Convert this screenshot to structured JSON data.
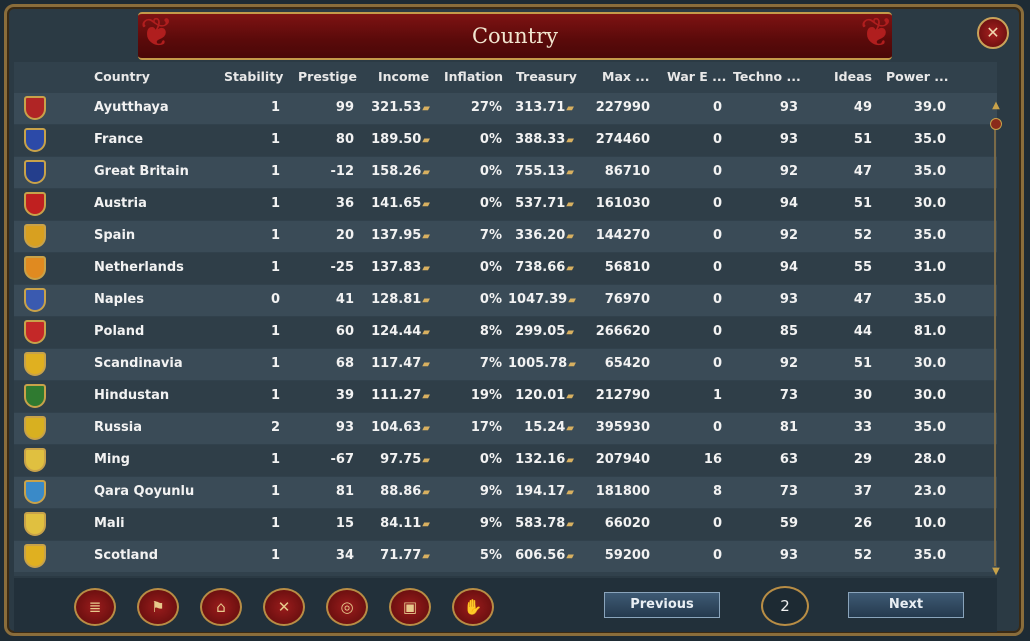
{
  "title": "Country",
  "columns": [
    "Country",
    "Stability",
    "Prestige",
    "Income",
    "Inflation",
    "Treasury",
    "Max ...",
    "War E ...",
    "Techno ...",
    "Ideas",
    "Power ..."
  ],
  "rows": [
    {
      "name": "Ayutthaya",
      "stability": "1",
      "prestige": "99",
      "income": "321.53",
      "inflation": "27%",
      "treasury": "313.71",
      "max": "227990",
      "war": "0",
      "tech": "93",
      "ideas": "49",
      "power": "39.0",
      "shield": "#b02525"
    },
    {
      "name": "France",
      "stability": "1",
      "prestige": "80",
      "income": "189.50",
      "inflation": "0%",
      "treasury": "388.33",
      "max": "274460",
      "war": "0",
      "tech": "93",
      "ideas": "51",
      "power": "35.0",
      "shield": "#2c4aa8"
    },
    {
      "name": "Great Britain",
      "stability": "1",
      "prestige": "-12",
      "income": "158.26",
      "inflation": "0%",
      "treasury": "755.13",
      "max": "86710",
      "war": "0",
      "tech": "92",
      "ideas": "47",
      "power": "35.0",
      "shield": "#243e8c"
    },
    {
      "name": "Austria",
      "stability": "1",
      "prestige": "36",
      "income": "141.65",
      "inflation": "0%",
      "treasury": "537.71",
      "max": "161030",
      "war": "0",
      "tech": "94",
      "ideas": "51",
      "power": "30.0",
      "shield": "#c02020"
    },
    {
      "name": "Spain",
      "stability": "1",
      "prestige": "20",
      "income": "137.95",
      "inflation": "7%",
      "treasury": "336.20",
      "max": "144270",
      "war": "0",
      "tech": "92",
      "ideas": "52",
      "power": "35.0",
      "shield": "#d8a020"
    },
    {
      "name": "Netherlands",
      "stability": "1",
      "prestige": "-25",
      "income": "137.83",
      "inflation": "0%",
      "treasury": "738.66",
      "max": "56810",
      "war": "0",
      "tech": "94",
      "ideas": "55",
      "power": "31.0",
      "shield": "#e08a20"
    },
    {
      "name": "Naples",
      "stability": "0",
      "prestige": "41",
      "income": "128.81",
      "inflation": "0%",
      "treasury": "1047.39",
      "max": "76970",
      "war": "0",
      "tech": "93",
      "ideas": "47",
      "power": "35.0",
      "shield": "#3a5ab0"
    },
    {
      "name": "Poland",
      "stability": "1",
      "prestige": "60",
      "income": "124.44",
      "inflation": "8%",
      "treasury": "299.05",
      "max": "266620",
      "war": "0",
      "tech": "85",
      "ideas": "44",
      "power": "81.0",
      "shield": "#c42828"
    },
    {
      "name": "Scandinavia",
      "stability": "1",
      "prestige": "68",
      "income": "117.47",
      "inflation": "7%",
      "treasury": "1005.78",
      "max": "65420",
      "war": "0",
      "tech": "92",
      "ideas": "51",
      "power": "30.0",
      "shield": "#e0b020"
    },
    {
      "name": "Hindustan",
      "stability": "1",
      "prestige": "39",
      "income": "111.27",
      "inflation": "19%",
      "treasury": "120.01",
      "max": "212790",
      "war": "1",
      "tech": "73",
      "ideas": "30",
      "power": "30.0",
      "shield": "#2f7a30"
    },
    {
      "name": "Russia",
      "stability": "2",
      "prestige": "93",
      "income": "104.63",
      "inflation": "17%",
      "treasury": "15.24",
      "max": "395930",
      "war": "0",
      "tech": "81",
      "ideas": "33",
      "power": "35.0",
      "shield": "#d8b020"
    },
    {
      "name": "Ming",
      "stability": "1",
      "prestige": "-67",
      "income": "97.75",
      "inflation": "0%",
      "treasury": "132.16",
      "max": "207940",
      "war": "16",
      "tech": "63",
      "ideas": "29",
      "power": "28.0",
      "shield": "#e0c040"
    },
    {
      "name": "Qara Qoyunlu",
      "stability": "1",
      "prestige": "81",
      "income": "88.86",
      "inflation": "9%",
      "treasury": "194.17",
      "max": "181800",
      "war": "8",
      "tech": "73",
      "ideas": "37",
      "power": "23.0",
      "shield": "#3a8ac8"
    },
    {
      "name": "Mali",
      "stability": "1",
      "prestige": "15",
      "income": "84.11",
      "inflation": "9%",
      "treasury": "583.78",
      "max": "66020",
      "war": "0",
      "tech": "59",
      "ideas": "26",
      "power": "10.0",
      "shield": "#e0c040"
    },
    {
      "name": "Scotland",
      "stability": "1",
      "prestige": "34",
      "income": "71.77",
      "inflation": "5%",
      "treasury": "606.56",
      "max": "59200",
      "war": "0",
      "tech": "93",
      "ideas": "52",
      "power": "35.0",
      "shield": "#e0b020"
    }
  ],
  "bottom_icons": [
    "ledger-icon",
    "flag-icon",
    "buildings-icon",
    "crossed-swords-icon",
    "coins-icon",
    "crate-icon",
    "handshake-icon"
  ],
  "pager": {
    "previous": "Previous",
    "next": "Next",
    "page": "2"
  }
}
